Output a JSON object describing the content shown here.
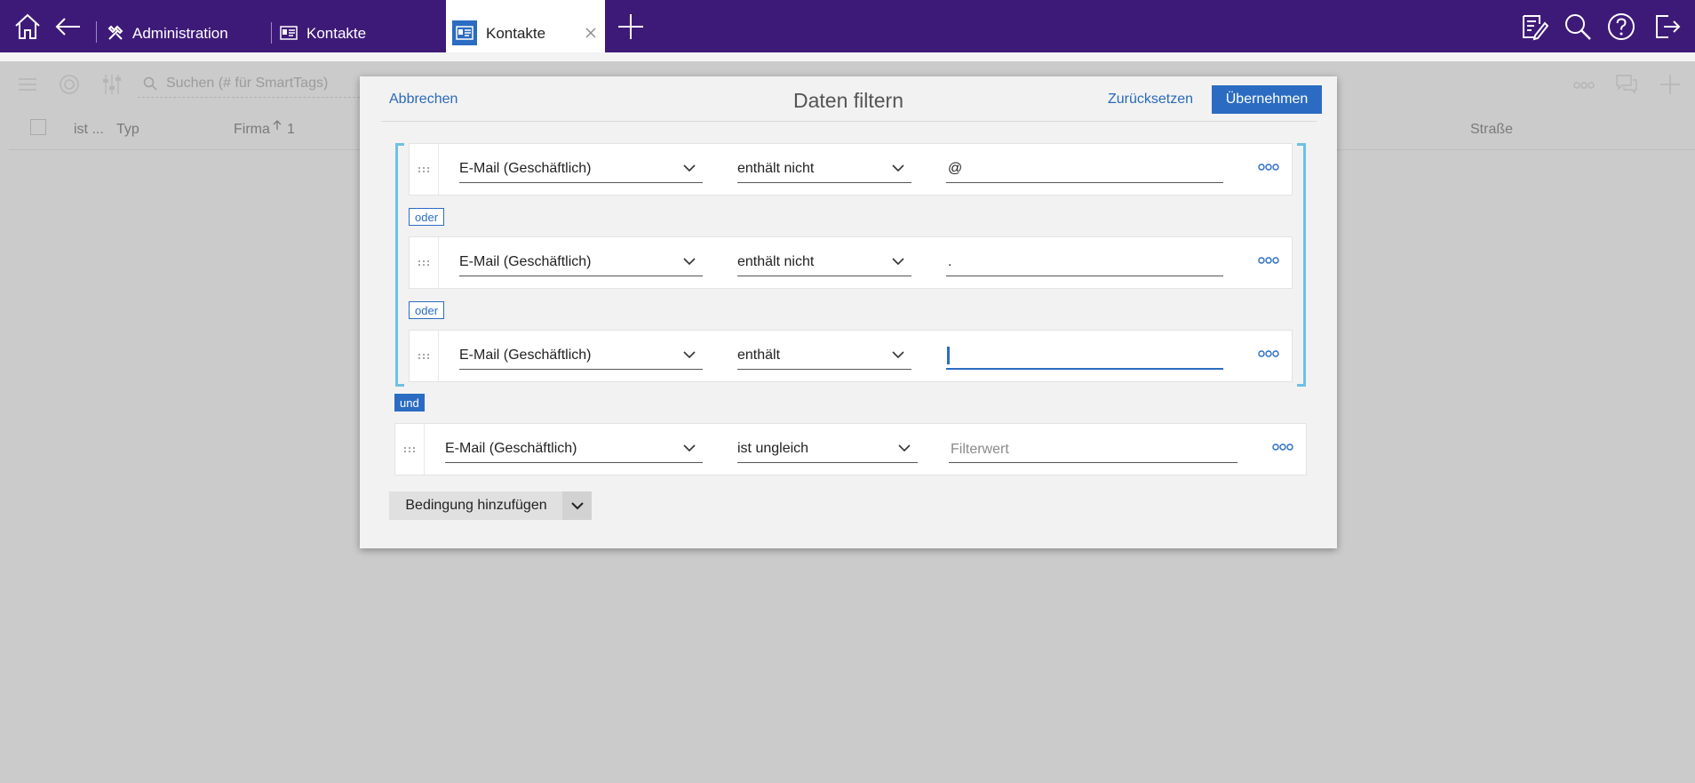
{
  "colors": {
    "topbar": "#3e1a78",
    "accent": "#2b6cc2",
    "bracket": "#6fc0e2"
  },
  "topbar": {
    "icons": [
      "home-icon",
      "back-icon",
      "new-tab-plus-icon",
      "notes-icon",
      "search-icon",
      "help-icon",
      "logout-icon"
    ],
    "tabs": [
      {
        "label": "Administration",
        "icon": "tools-icon"
      },
      {
        "label": "Kontakte",
        "icon": "contact-card-icon"
      },
      {
        "label": "Kontakte",
        "icon": "contact-card-icon",
        "active": true
      }
    ]
  },
  "background": {
    "search_placeholder": "Suchen (# für SmartTags)",
    "columns": {
      "ist": "ist ...",
      "typ": "Typ",
      "firma": "Firma",
      "firma_sort": "1",
      "strasse": "Straße"
    }
  },
  "dialog": {
    "title": "Daten filtern",
    "cancel_label": "Abbrechen",
    "reset_label": "Zurücksetzen",
    "apply_label": "Übernehmen",
    "group_conditions": [
      {
        "field": "E-Mail (Geschäftlich)",
        "operator": "enthält nicht",
        "value": "@"
      },
      {
        "field": "E-Mail (Geschäftlich)",
        "operator": "enthält nicht",
        "value": "."
      },
      {
        "field": "E-Mail (Geschäftlich)",
        "operator": "enthält",
        "value": ""
      }
    ],
    "or_label": "oder",
    "and_label": "und",
    "condition": {
      "field": "E-Mail (Geschäftlich)",
      "operator": "ist ungleich",
      "placeholder": "Filterwert"
    },
    "add_condition_label": "Bedingung hinzufügen"
  }
}
